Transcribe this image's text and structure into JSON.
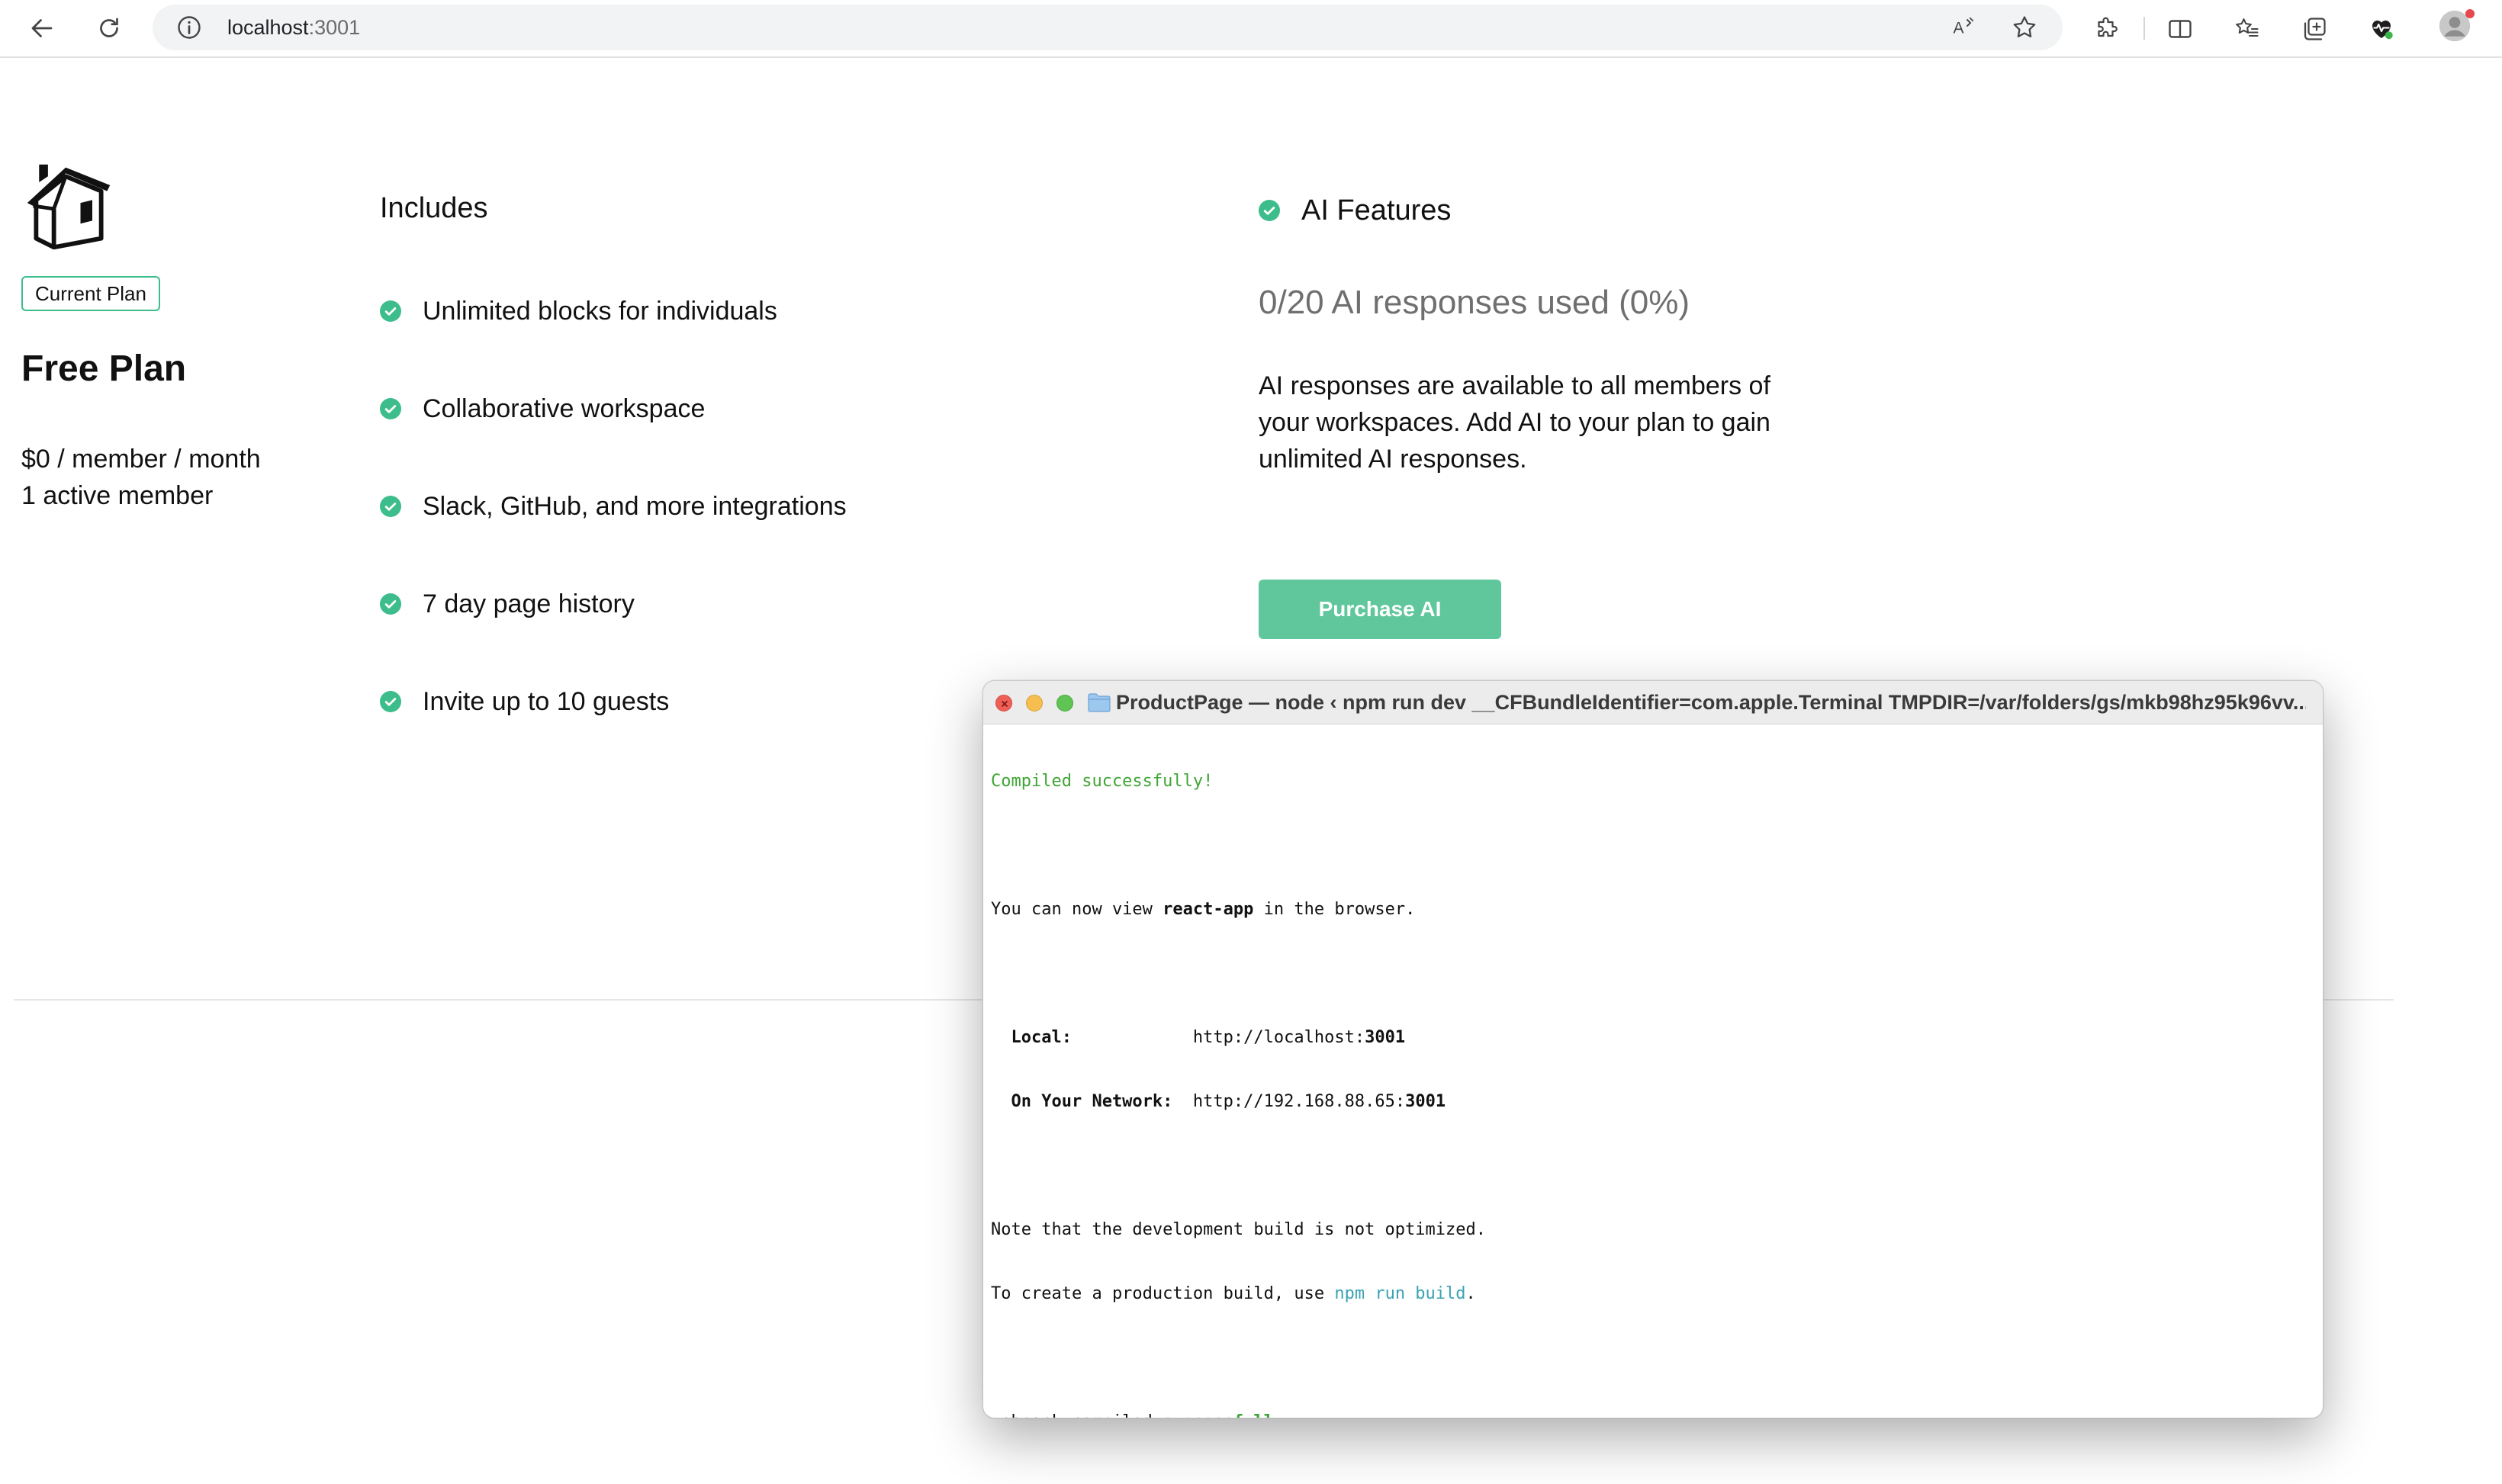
{
  "browser": {
    "url_host": "localhost",
    "url_port": ":3001",
    "icons": {
      "back": "back-arrow-icon",
      "refresh": "refresh-icon",
      "site_info": "info-icon",
      "read_aloud": "read-aloud-icon",
      "favorite": "star-icon",
      "extensions": "puzzle-icon",
      "split_screen": "split-screen-icon",
      "favorites": "favorites-list-icon",
      "collections": "collections-icon",
      "browser_essentials": "heart-pulse-icon",
      "profile": "profile-icon"
    }
  },
  "plan": {
    "badge": "Current Plan",
    "name": "Free Plan",
    "price": "$0 / member / month",
    "members": "1 active member",
    "icon": "house-icon"
  },
  "includes": {
    "title": "Includes",
    "items": [
      "Unlimited blocks for individuals",
      "Collaborative workspace",
      "Slack, GitHub, and more integrations",
      "7 day page history",
      "Invite up to 10 guests"
    ]
  },
  "ai": {
    "title": "AI Features",
    "usage": "0/20 AI responses used (0%)",
    "description": "AI responses are available to all members of your workspaces. Add AI to your plan to gain unlimited AI responses.",
    "button": "Purchase AI"
  },
  "terminal": {
    "title": "ProductPage — node ‹ npm run dev __CFBundleIdentifier=com.apple.Terminal TMPDIR=/var/folders/gs/mkb98hz95k96vv...",
    "compiled": "Compiled successfully!",
    "view_prefix": "You can now view ",
    "view_app": "react-app",
    "view_suffix": " in the browser.",
    "local_label": "  Local:",
    "local_pad": "            ",
    "local_url_base": "http://localhost:",
    "local_url_port": "3001",
    "network_label": "  On Your Network:",
    "network_pad": "  ",
    "network_url_base": "http://192.168.88.65:",
    "network_url_port": "3001",
    "note": "Note that the development build is not optimized.",
    "create_prefix": "To create a production build, use ",
    "create_cmd": "npm run build",
    "create_suffix": ".",
    "webpack_prefix": "webpack compiled ",
    "webpack_status": "successfully"
  },
  "colors": {
    "accent_green": "#5fc79b",
    "check_green": "#3dbd8c",
    "terminal_green": "#3fa535",
    "terminal_cyan": "#3aa3b3"
  }
}
